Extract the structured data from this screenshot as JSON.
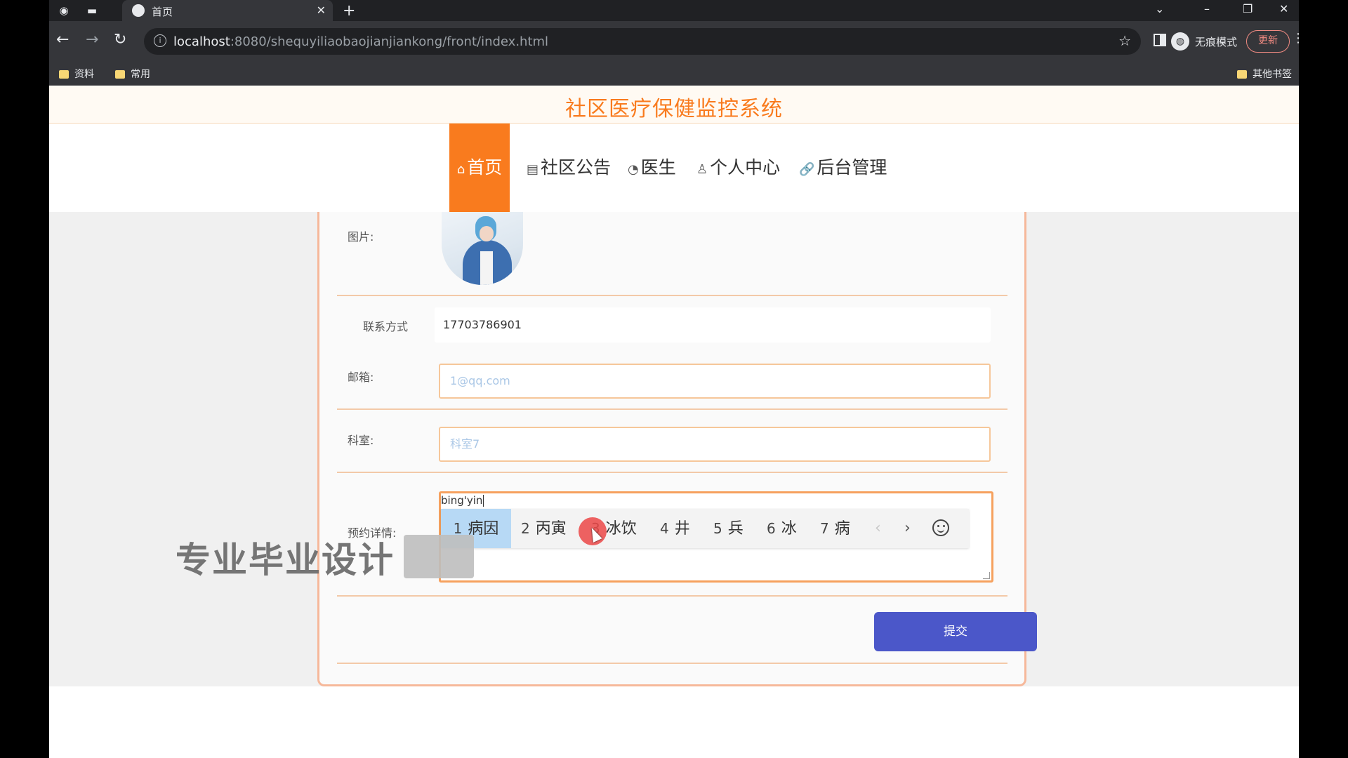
{
  "browser": {
    "tab_title": "首页",
    "url_host": "localhost",
    "url_rest": ":8080/shequyiliaobaojianjiankong/front/index.html",
    "incognito_label": "无痕模式",
    "update_label": "更新",
    "bookmarks": [
      "资料",
      "常用"
    ],
    "other_bookmarks": "其他书签"
  },
  "site": {
    "title": "社区医疗保健监控系统",
    "nav": [
      "首页",
      "社区公告",
      "医生",
      "个人中心",
      "后台管理"
    ]
  },
  "form": {
    "image_label": "图片:",
    "phone_label": "联系方式",
    "phone_value": "17703786901",
    "email_label": "邮箱:",
    "email_placeholder": "1@qq.com",
    "dept_label": "科室:",
    "dept_placeholder": "科室7",
    "detail_label": "预约详情:",
    "detail_typing": "bing'yin",
    "submit_label": "提交"
  },
  "ime": {
    "candidates": [
      {
        "num": "1",
        "text": "病因"
      },
      {
        "num": "2",
        "text": "丙寅"
      },
      {
        "num": "3",
        "text": "冰饮"
      },
      {
        "num": "4",
        "text": "井"
      },
      {
        "num": "5",
        "text": "兵"
      },
      {
        "num": "6",
        "text": "冰"
      },
      {
        "num": "7",
        "text": "病"
      }
    ]
  },
  "overlay": {
    "watermark": "专业毕业设计"
  },
  "colors": {
    "accent": "#f97b1e",
    "submit": "#4b57c9",
    "highlight": "#b7d9f5"
  }
}
